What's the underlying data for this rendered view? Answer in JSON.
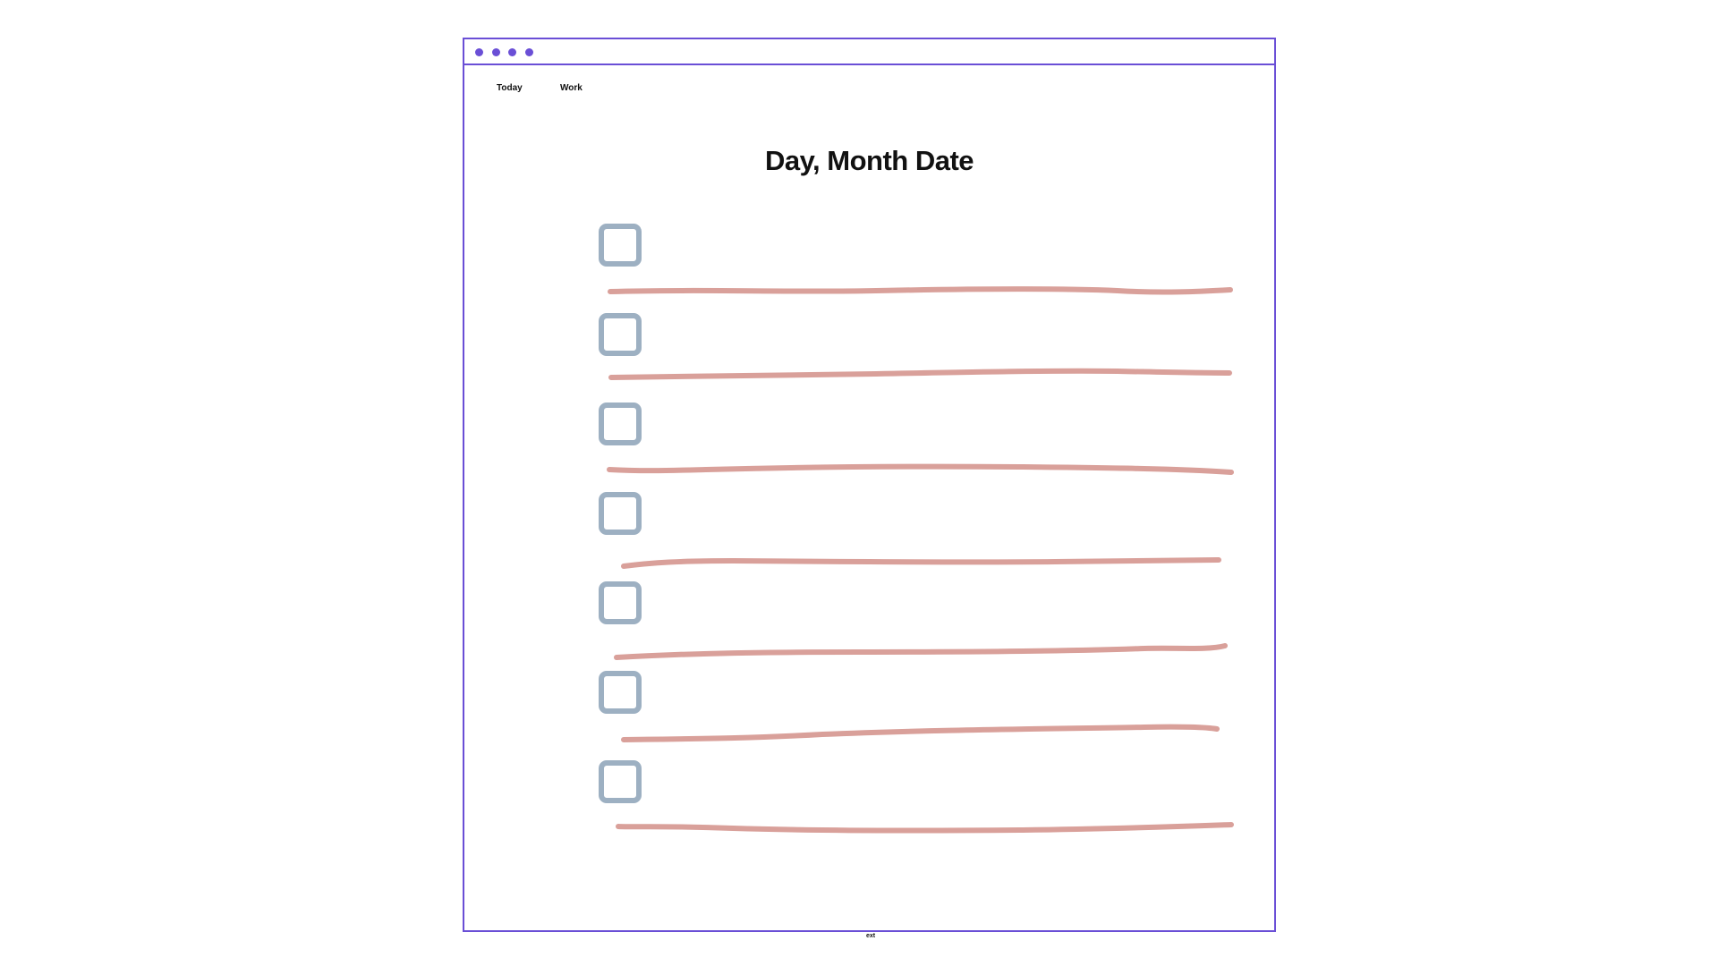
{
  "window": {
    "title_dots": [
      "dot",
      "dot",
      "dot",
      "dot"
    ]
  },
  "nav": {
    "items": [
      {
        "label": "Today"
      },
      {
        "label": "Work"
      }
    ]
  },
  "main": {
    "title": "Day, Month Date",
    "tasks": [
      {
        "checked": false,
        "text": ""
      },
      {
        "checked": false,
        "text": ""
      },
      {
        "checked": false,
        "text": ""
      },
      {
        "checked": false,
        "text": ""
      },
      {
        "checked": false,
        "text": ""
      },
      {
        "checked": false,
        "text": ""
      },
      {
        "checked": false,
        "text": ""
      }
    ]
  },
  "footer": {
    "text": "ext"
  },
  "colors": {
    "accent": "#6a4fd6",
    "checkbox": "#9db0c2",
    "line": "#d9a09a"
  }
}
